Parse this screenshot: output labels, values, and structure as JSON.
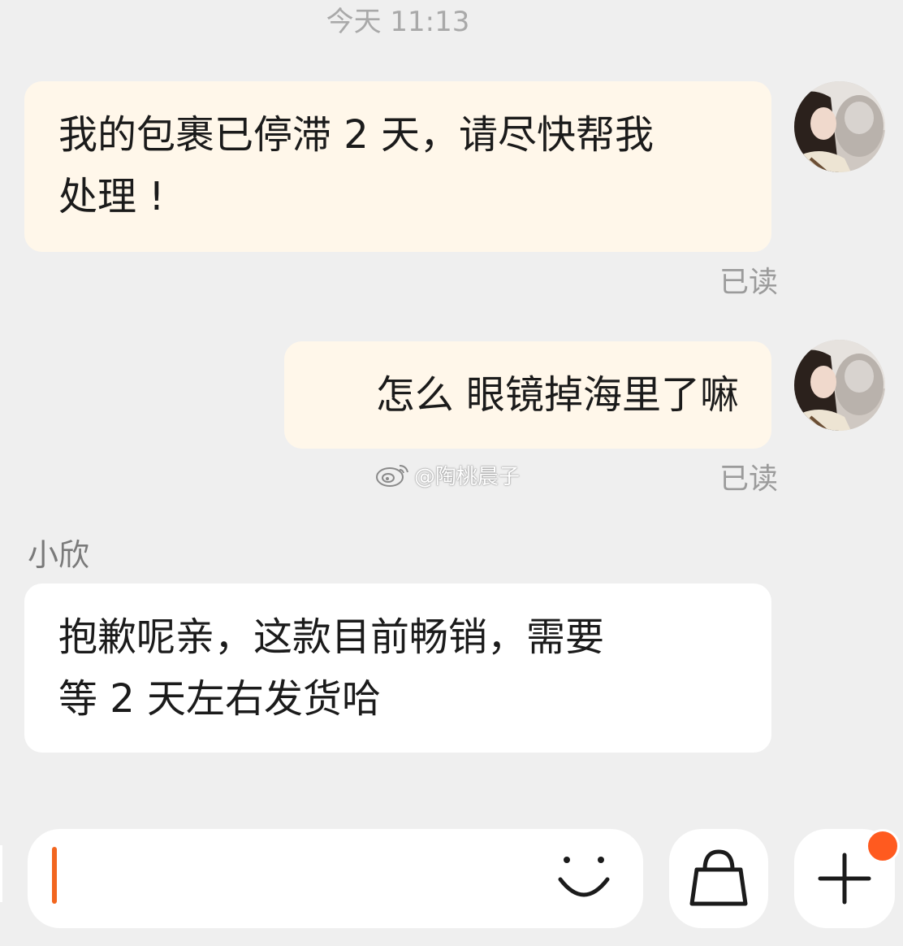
{
  "timestamp": "今天 11:13",
  "messages": [
    {
      "text_line1": "我的包裹已停滞 2 天，请尽快帮我",
      "text_line2": "处理 !",
      "status": "已读"
    },
    {
      "text": "怎么 眼镜掉海里了嘛",
      "status": "已读"
    },
    {
      "sender": "小欣",
      "text_line1": "抱歉呢亲，这款目前畅销，需要",
      "text_line2": "等 2 天左右发货哈"
    }
  ],
  "watermark": "@陶桃晨子",
  "input": {
    "value": "",
    "emoji_icon": "smiley-icon",
    "shop_icon": "shopping-bag-icon",
    "more_icon": "plus-icon",
    "notification_dot_color": "#ff5a1f"
  },
  "colors": {
    "background": "#efefef",
    "self_bubble": "#fff7ea",
    "other_bubble": "#ffffff",
    "caret": "#f2661f"
  }
}
